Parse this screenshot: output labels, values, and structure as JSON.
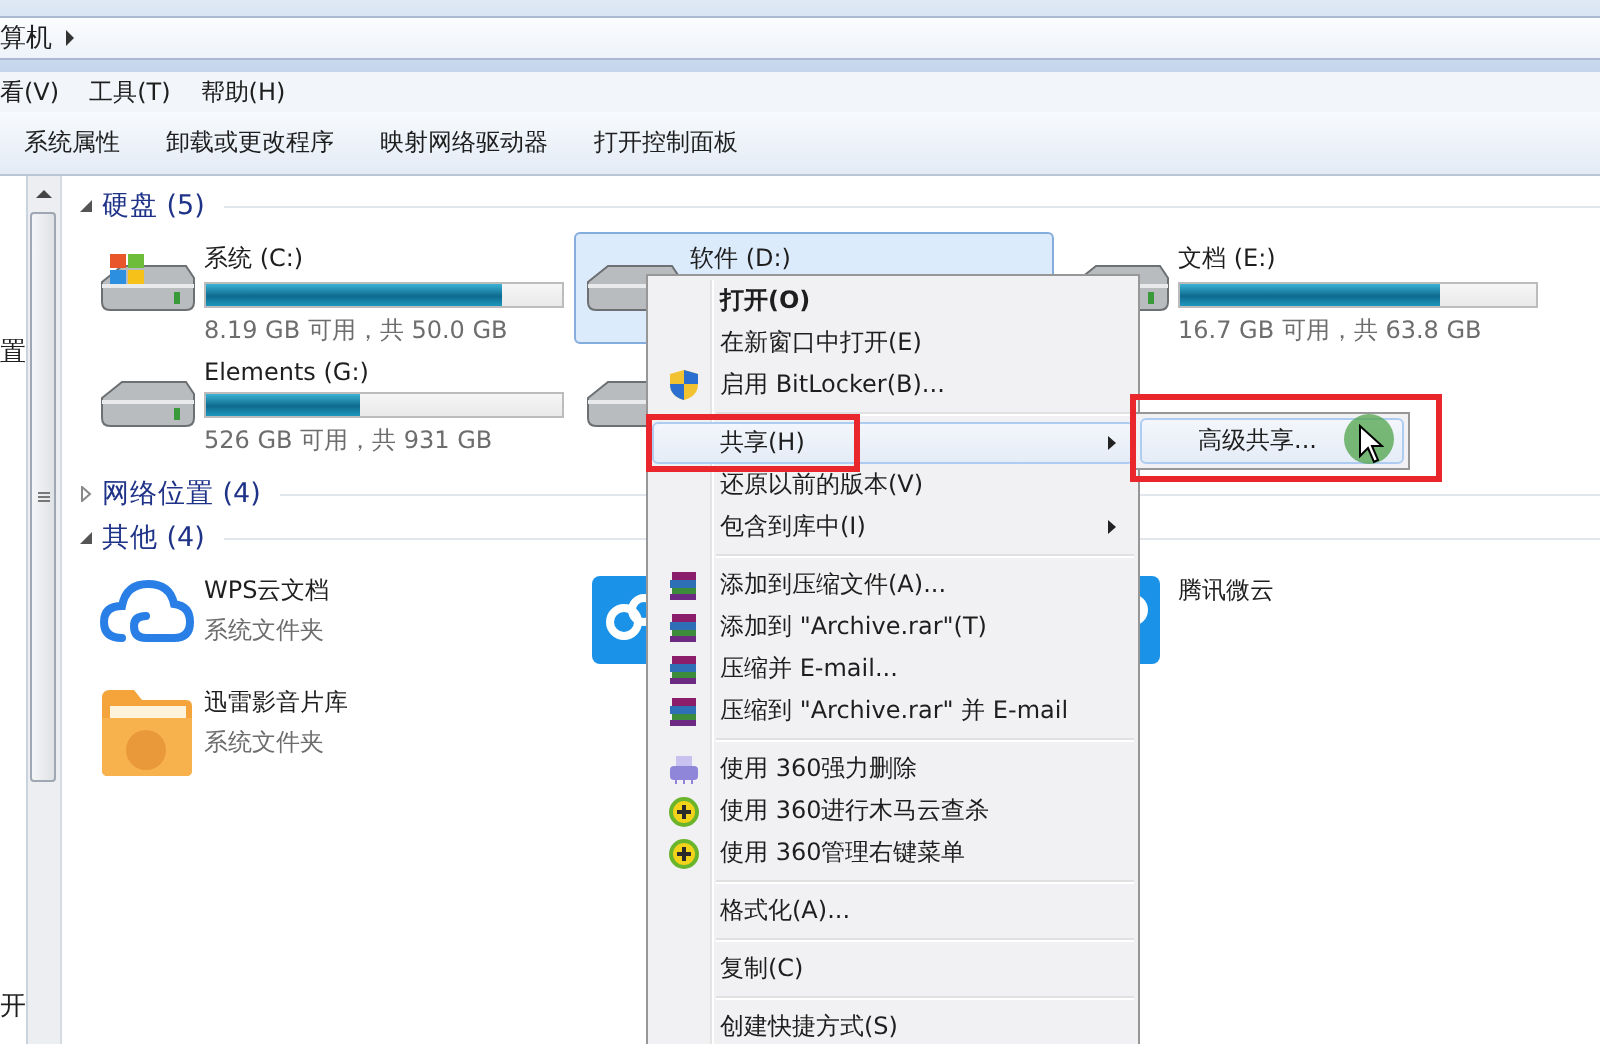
{
  "address_bar": {
    "path": "算机"
  },
  "menu_bar": [
    {
      "label": "看(V)"
    },
    {
      "label": "工具(T)"
    },
    {
      "label": "帮助(H)"
    }
  ],
  "toolbar": [
    "系统属性",
    "卸载或更改程序",
    "映射网络驱动器",
    "打开控制面板"
  ],
  "nav_pane": {
    "items": [
      "置",
      "开"
    ]
  },
  "groups": [
    {
      "title": "硬盘 (5)",
      "expanded": true,
      "items": [
        {
          "kind": "windows-drive",
          "name": "系统 (C:)",
          "level": 0.83,
          "info": "8.19 GB 可用，共 50.0 GB",
          "selected": false
        },
        {
          "kind": "drive",
          "name": "软件 (D:)",
          "selected": true
        },
        {
          "kind": "drive",
          "name": "文档 (E:)",
          "level": 0.73,
          "info": "16.7 GB 可用，共 63.8 GB",
          "selected": false
        },
        {
          "kind": "drive",
          "name": "Elements (G:)",
          "level": 0.43,
          "info": "526 GB 可用，共 931 GB",
          "selected": false
        },
        {
          "kind": "drive",
          "selected": false
        }
      ]
    },
    {
      "title": "网络位置 (4)",
      "expanded": false
    },
    {
      "title": "其他 (4)",
      "expanded": true,
      "items": [
        {
          "kind": "cloud",
          "name": "WPS云文档",
          "info": "系统文件夹",
          "selected": false
        },
        {
          "kind": "app",
          "selected": false
        },
        {
          "kind": "app",
          "name": "腾讯微云",
          "selected": false
        },
        {
          "kind": "folder",
          "name": "迅雷影音片库",
          "info": "系统文件夹",
          "selected": false
        }
      ]
    }
  ],
  "context_menu": [
    {
      "kind": "plain",
      "label": "打开(O)",
      "bold": true,
      "submenu": false,
      "selected": false
    },
    {
      "kind": "plain",
      "label": "在新窗口中打开(E)",
      "bold": false,
      "submenu": false,
      "selected": false
    },
    {
      "kind": "shield",
      "label": "启用 BitLocker(B)...",
      "bold": false,
      "submenu": false,
      "selected": false
    },
    {
      "kind": "separator"
    },
    {
      "kind": "plain",
      "label": "共享(H)",
      "bold": false,
      "submenu": true,
      "selected": true
    },
    {
      "kind": "plain",
      "label": "还原以前的版本(V)",
      "bold": false,
      "submenu": false,
      "selected": false
    },
    {
      "kind": "plain",
      "label": "包含到库中(I)",
      "bold": false,
      "submenu": true,
      "selected": false
    },
    {
      "kind": "separator"
    },
    {
      "kind": "archive",
      "label": "添加到压缩文件(A)...",
      "bold": false,
      "submenu": false,
      "selected": false
    },
    {
      "kind": "archive",
      "label": "添加到 \"Archive.rar\"(T)",
      "bold": false,
      "submenu": false,
      "selected": false
    },
    {
      "kind": "archive",
      "label": "压缩并 E-mail...",
      "bold": false,
      "submenu": false,
      "selected": false
    },
    {
      "kind": "archive",
      "label": "压缩到 \"Archive.rar\" 并 E-mail",
      "bold": false,
      "submenu": false,
      "selected": false
    },
    {
      "kind": "separator"
    },
    {
      "kind": "shredder",
      "label": "使用 360强力删除",
      "bold": false,
      "submenu": false,
      "selected": false
    },
    {
      "kind": "guard",
      "label": "使用 360进行木马云查杀",
      "bold": false,
      "submenu": false,
      "selected": false
    },
    {
      "kind": "guard",
      "label": "使用 360管理右键菜单",
      "bold": false,
      "submenu": false,
      "selected": false
    },
    {
      "kind": "separator"
    },
    {
      "kind": "plain",
      "label": "格式化(A)...",
      "bold": false,
      "submenu": false,
      "selected": false
    },
    {
      "kind": "separator"
    },
    {
      "kind": "plain",
      "label": "复制(C)",
      "bold": false,
      "submenu": false,
      "selected": false
    },
    {
      "kind": "separator"
    },
    {
      "kind": "plain",
      "label": "创建快捷方式(S)",
      "bold": false,
      "submenu": false,
      "selected": false
    }
  ],
  "submenu": [
    {
      "label": "高级共享...",
      "selected": true
    }
  ]
}
